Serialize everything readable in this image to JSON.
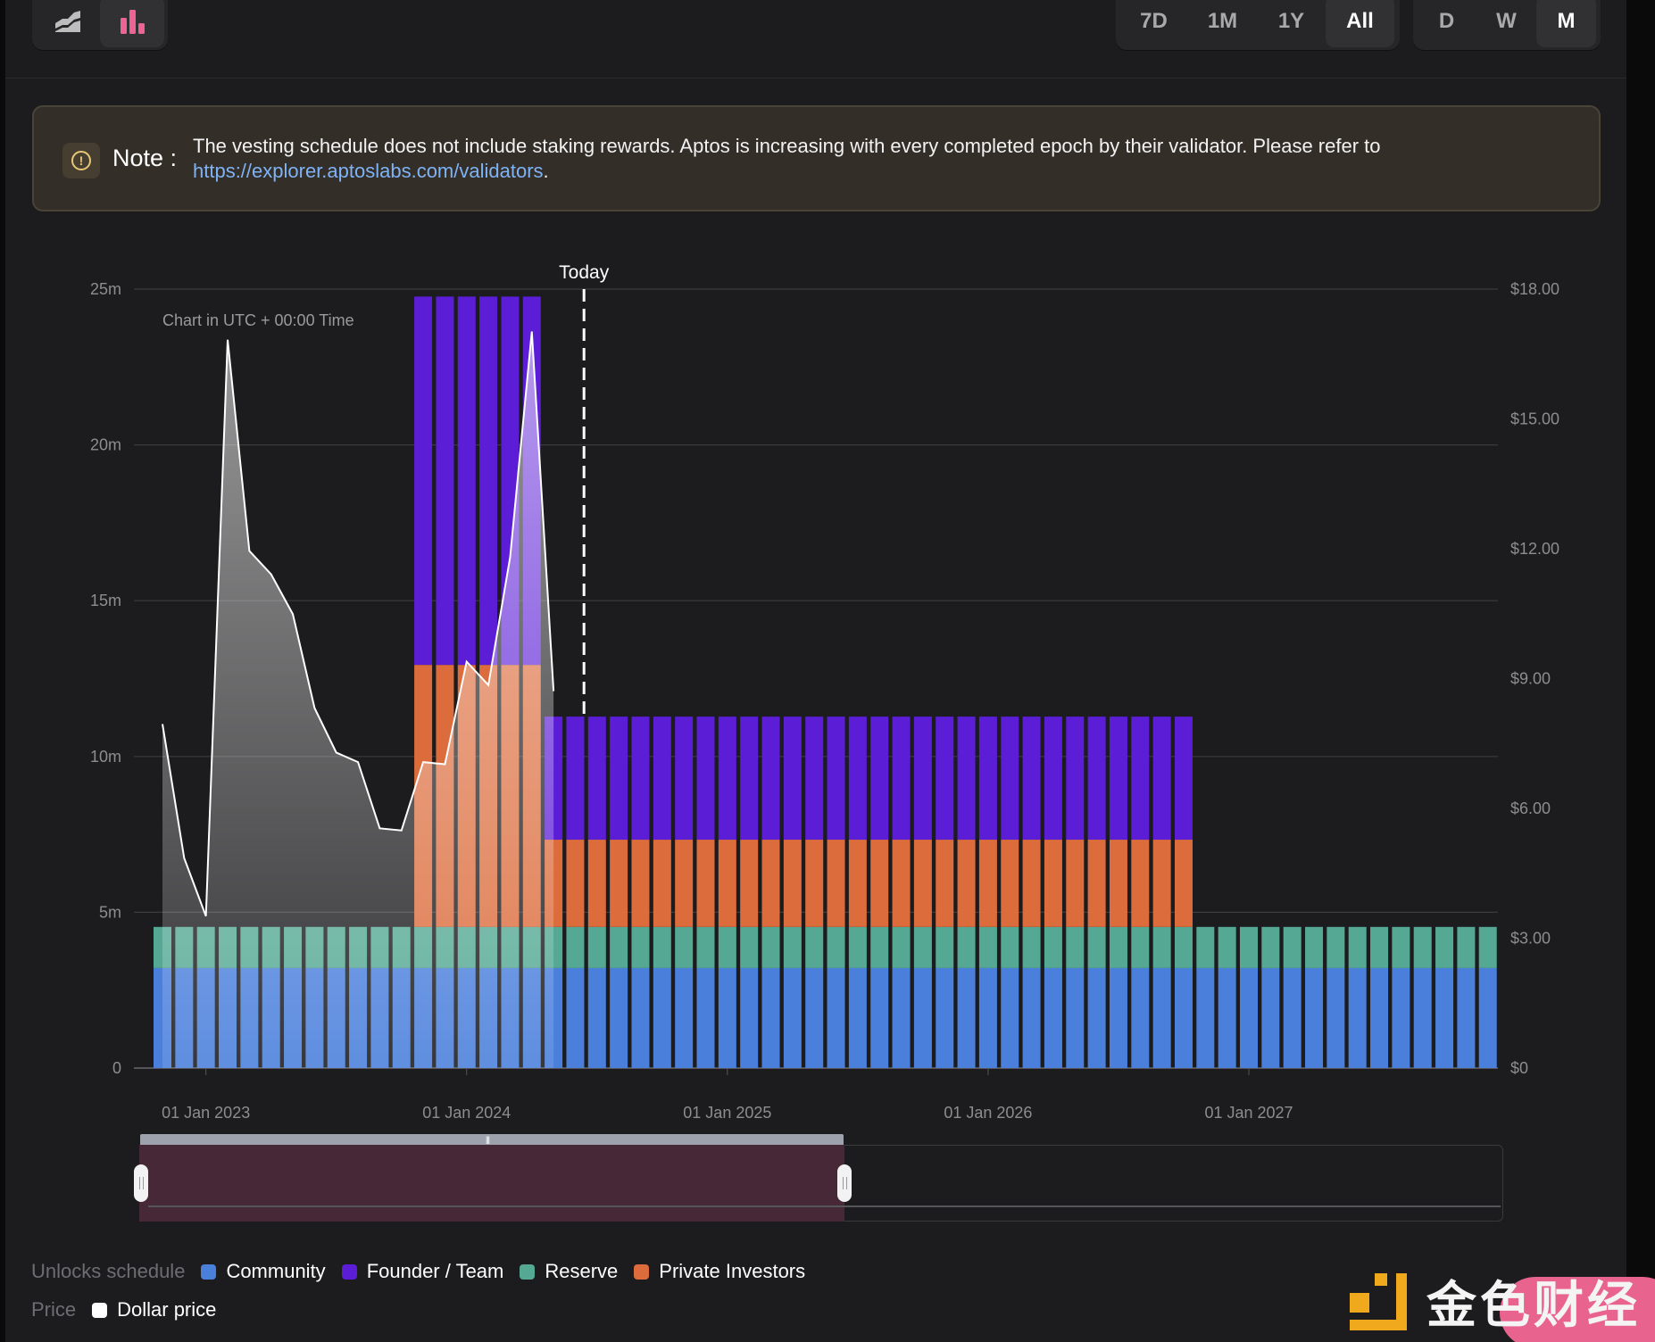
{
  "toolbar": {
    "chart_types": [
      {
        "name": "area-chart",
        "icon": "area-chart-icon",
        "active": false
      },
      {
        "name": "bar-chart",
        "icon": "bar-chart-icon",
        "active": true
      }
    ],
    "ranges": [
      {
        "label": "7D",
        "active": false
      },
      {
        "label": "1M",
        "active": false
      },
      {
        "label": "1Y",
        "active": false
      },
      {
        "label": "All",
        "active": true
      }
    ],
    "intervals": [
      {
        "label": "D",
        "active": false
      },
      {
        "label": "W",
        "active": false
      },
      {
        "label": "M",
        "active": true
      }
    ]
  },
  "note": {
    "icon": "info-exclamation-icon",
    "label": "Note :",
    "text": "The vesting schedule does not include staking rewards. Aptos is increasing with every completed epoch by their validator. Please refer to ",
    "link_text": "https://explorer.aptoslabs.com/validators",
    "trailing": "."
  },
  "legend": {
    "unlocks_label": "Unlocks schedule",
    "price_label": "Price"
  },
  "watermark": {
    "text": "金色财经"
  },
  "chart_data": {
    "type": "bar",
    "stacked": true,
    "annotation_today": "Today",
    "today_month_index": 19.4,
    "subtitle": "Chart in UTC + 00:00 Time",
    "x_start": "2022-11",
    "x_months": 62,
    "x_tick_labels": [
      {
        "label": "01 Jan 2023",
        "month_index": 2
      },
      {
        "label": "01 Jan 2024",
        "month_index": 14
      },
      {
        "label": "01 Jan 2025",
        "month_index": 26
      },
      {
        "label": "01 Jan 2026",
        "month_index": 38
      },
      {
        "label": "01 Jan 2027",
        "month_index": 50
      }
    ],
    "y_left": {
      "min": 0,
      "max": 25,
      "unit": "m",
      "ticks": [
        "0",
        "5m",
        "10m",
        "15m",
        "20m",
        "25m"
      ],
      "tick_values": [
        0,
        5,
        10,
        15,
        20,
        25
      ]
    },
    "y_right": {
      "min": 0,
      "max": 18,
      "ticks": [
        "$0",
        "$3.00",
        "$6.00",
        "$9.00",
        "$12.00",
        "$15.00",
        "$18.00"
      ],
      "tick_values": [
        0,
        3,
        6,
        9,
        12,
        15,
        18
      ]
    },
    "grid": true,
    "series": [
      {
        "name": "Community",
        "color": "#4a7fdc",
        "segments": [
          {
            "from": 0,
            "to": 61,
            "value": 3.21
          }
        ]
      },
      {
        "name": "Reserve",
        "color": "#55a994",
        "segments": [
          {
            "from": 0,
            "to": 61,
            "value": 1.32
          }
        ]
      },
      {
        "name": "Private Investors",
        "color": "#dc6c3c",
        "segments": [
          {
            "from": 12,
            "to": 17,
            "value": 8.41
          },
          {
            "from": 18,
            "to": 47,
            "value": 2.8
          }
        ]
      },
      {
        "name": "Founder / Team",
        "color": "#5b1dd6",
        "segments": [
          {
            "from": 12,
            "to": 17,
            "value": 11.82
          },
          {
            "from": 18,
            "to": 47,
            "value": 3.95
          }
        ]
      }
    ],
    "price_series": {
      "name": "Dollar price",
      "color": "#ffffff",
      "start_index": 0,
      "values": [
        7.95,
        4.85,
        3.51,
        16.83,
        11.95,
        11.41,
        10.49,
        8.32,
        7.29,
        7.07,
        5.54,
        5.49,
        7.07,
        7.02,
        9.39,
        8.85,
        11.8,
        17.02,
        8.71
      ]
    },
    "navigator": {
      "selected_from_fraction": 0.0,
      "selected_to_fraction": 0.52
    }
  }
}
